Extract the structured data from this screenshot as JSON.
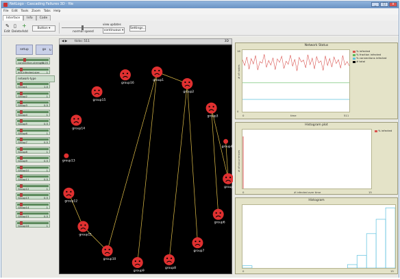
{
  "window": {
    "title": "NetLogo · Cascading Failures 3D · file",
    "controls": {
      "minimize": "_",
      "maximize": "□",
      "close": "x"
    }
  },
  "menu": [
    "File",
    "Edit",
    "Tools",
    "Zoom",
    "Tabs",
    "Help"
  ],
  "tabs": [
    "Interface",
    "Info",
    "Code"
  ],
  "toolbar": {
    "edit_label": "Edit",
    "delete_label": "Delete",
    "add_label": "Add",
    "widget_type": "Button",
    "speed_label": "normal speed",
    "update_label": "view updates",
    "update_mode": "continuous",
    "settings_label": "Settings..."
  },
  "controls": {
    "setup_label": "setup",
    "go_label": "go",
    "choosers": [
      {
        "label": "network-type",
        "value": ""
      }
    ],
    "sliders": [
      {
        "label": "connection-strength",
        "value": "0.05",
        "level": 0.2
      },
      {
        "label": "init-infected-size",
        "value": "1",
        "level": 0.1
      },
      {
        "label": "Group1",
        "value": "1.0",
        "level": 0.1
      },
      {
        "label": "Group2",
        "value": "1",
        "level": 0.1
      },
      {
        "label": "Group3",
        "value": "0.5",
        "level": 0.1
      },
      {
        "label": "Group4",
        "value": "1",
        "level": 0.1
      },
      {
        "label": "Group5",
        "value": "0.5",
        "level": 0.1
      },
      {
        "label": "Group6",
        "value": "1",
        "level": 0.1
      },
      {
        "label": "Group7",
        "value": "0.5",
        "level": 0.1
      },
      {
        "label": "Group8",
        "value": "1",
        "level": 0.1
      },
      {
        "label": "Group9",
        "value": "0.5",
        "level": 0.1
      },
      {
        "label": "Group10",
        "value": "1",
        "level": 0.1
      },
      {
        "label": "Group11",
        "value": "0.5",
        "level": 0.1
      },
      {
        "label": "Group12",
        "value": "1",
        "level": 0.1
      },
      {
        "label": "Group13",
        "value": "0.5",
        "level": 0.1
      },
      {
        "label": "Group14",
        "value": "1",
        "level": 0.1
      },
      {
        "label": "Group15",
        "value": "0.5",
        "level": 0.1
      },
      {
        "label": "Group16",
        "value": "1",
        "level": 0.1
      }
    ]
  },
  "view": {
    "ticks_label": "ticks: 511",
    "threed_label": "3D"
  },
  "agents": [
    "group1",
    "group2",
    "group3",
    "group4",
    "group5",
    "group6",
    "group7",
    "group8",
    "group9",
    "group10",
    "group11",
    "group12",
    "group13",
    "group14",
    "group15",
    "group16"
  ],
  "plots": {
    "status": {
      "title": "Network Status",
      "xlabel": "time",
      "ylabel": "# of nodes",
      "xmin": "0",
      "xmax": "511",
      "ymax": "16",
      "ymin": "0",
      "legend": [
        {
          "name": "% infected",
          "color": "#d9534f"
        },
        {
          "name": "% fraction infected",
          "color": "#5cb85c"
        },
        {
          "name": "% connections infected",
          "color": "#5bc0de"
        },
        {
          "name": "# total",
          "color": "#000000"
        }
      ]
    },
    "histo": {
      "title": "Histogram plot",
      "xlabel": "# infected over time",
      "ylabel": "# of occurrences",
      "xmin": "0",
      "xmax": "15",
      "legend": [
        {
          "name": "% infected",
          "color": "#d9534f"
        }
      ]
    },
    "hist": {
      "title": "Histogram",
      "xmin": "0",
      "xmax": "15"
    }
  },
  "chart_data": [
    {
      "type": "line",
      "title": "Network Status",
      "xlabel": "time",
      "ylabel": "# of nodes",
      "xlim": [
        0,
        511
      ],
      "ylim": [
        0,
        16
      ],
      "series": [
        {
          "name": "% infected",
          "values": [
            13.5,
            12.0,
            14.2,
            11.0,
            13.8,
            12.4,
            14.6,
            10.8,
            13.0,
            12.6,
            14.9,
            11.5,
            13.3,
            12.1,
            14.0,
            10.9,
            13.7,
            12.8,
            14.4,
            11.2,
            13.1,
            12.3,
            14.7,
            11.8,
            13.6,
            10.6,
            14.1,
            12.9,
            13.4,
            11.4,
            14.8,
            12.2,
            13.9,
            11.1,
            14.3,
            12.7,
            13.2,
            10.7,
            14.5,
            12.0,
            13.8,
            11.6,
            14.2,
            12.5,
            13.5,
            11.3,
            14.6,
            12.1,
            13.0,
            11.9
          ]
        },
        {
          "name": "% fraction infected",
          "values": [
            7.5,
            7.5
          ]
        },
        {
          "name": "% connections infected",
          "values": [
            3.2,
            3.2
          ]
        }
      ]
    },
    {
      "type": "bar",
      "title": "Histogram",
      "xlim": [
        0,
        15
      ],
      "bins": [
        0.4,
        0,
        0,
        0,
        0,
        0,
        0,
        0,
        0,
        0,
        0,
        0.6,
        2.2,
        6.0,
        8.5,
        10.5
      ]
    }
  ]
}
